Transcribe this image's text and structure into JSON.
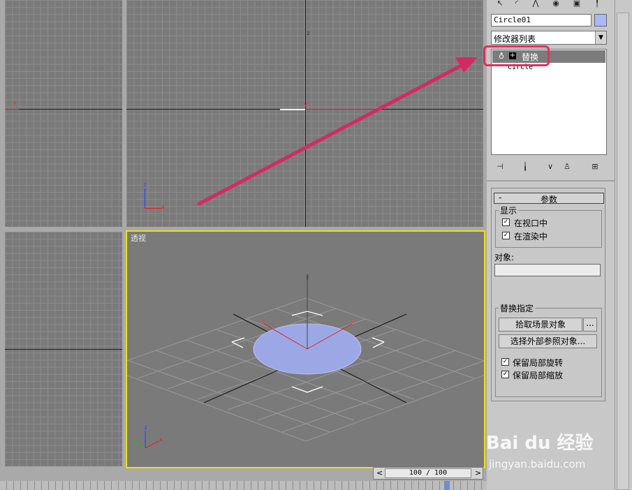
{
  "viewports": {
    "perspective_label": "透视",
    "axis_x": "x",
    "axis_y": "y",
    "axis_z": "z"
  },
  "object_name": "Circle01",
  "modifier_list_label": "修改器列表",
  "stack": {
    "items": [
      {
        "label": "替换",
        "expand_glyph": "+"
      },
      {
        "label": "Circle"
      }
    ]
  },
  "rollout": {
    "collapse_glyph": "-",
    "title": "参数",
    "display_group": "显示",
    "in_viewport": "在视口中",
    "in_render": "在渲染中",
    "object_label": "对象:",
    "object_value": "",
    "replace_group": "替换指定",
    "pick_scene_button": "拾取场景对象",
    "ellipsis_button": "...",
    "xref_button": "选择外部参照对象...",
    "keep_rotation": "保留局部旋转",
    "keep_scale": "保留局部缩放"
  },
  "checks": {
    "in_viewport": true,
    "in_render": true,
    "keep_rotation": true,
    "keep_scale": true
  },
  "timeline": {
    "frame_text": "100 / 100",
    "prev": "<",
    "next": ">"
  },
  "watermark": {
    "logo": "Bai du 经验",
    "url": "jingyan.baidu.com"
  },
  "colors": {
    "highlight_box": "#e0305f",
    "arrow": "#d42a62",
    "active_viewport_border": "#f0e000",
    "color_swatch": "#a9b9f5",
    "circle_fill": "#9ca8e6"
  }
}
